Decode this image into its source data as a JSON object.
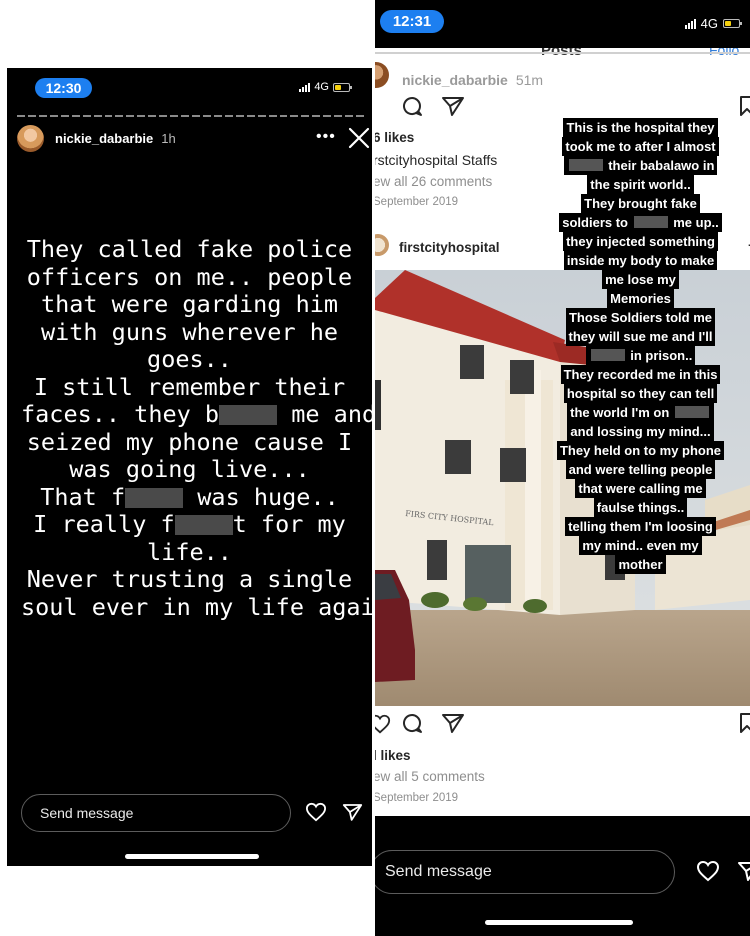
{
  "left_story": {
    "status_time": "12:30",
    "network": "4G",
    "username": "nickie_dabarbie",
    "posted_ago": "1h",
    "more_label": "•••",
    "text_lines": [
      {
        "parts": [
          "They called fake police"
        ]
      },
      {
        "parts": [
          "officers on me.. people"
        ]
      },
      {
        "parts": [
          "that were garding him"
        ]
      },
      {
        "parts": [
          "with guns wherever he"
        ]
      },
      {
        "parts": [
          "goes.."
        ]
      },
      {
        "parts": [
          "I still remember their"
        ]
      },
      {
        "parts": [
          "faces.. they b",
          "",
          " me and"
        ]
      },
      {
        "parts": [
          "seized my phone cause I"
        ]
      },
      {
        "parts": [
          "was going live..."
        ]
      },
      {
        "parts": [
          "That f",
          "",
          " was huge.."
        ]
      },
      {
        "parts": [
          "I really f",
          "",
          "t for my"
        ]
      },
      {
        "parts": [
          "life.."
        ]
      },
      {
        "parts": [
          "Never trusting a single"
        ]
      },
      {
        "parts": [
          "soul ever in my life again"
        ]
      }
    ],
    "message_placeholder": "Send message"
  },
  "right_story": {
    "status_time": "12:31",
    "network": "4G",
    "feed_header": {
      "title": "Posts",
      "follow": "Follo"
    },
    "post1": {
      "username": "nickie_dabarbie",
      "posted_ago": "51m",
      "likes": "6 likes",
      "caption": "rstcityhospital Staffs",
      "comments": "ew all 26 comments",
      "date": "September 2019"
    },
    "post2": {
      "account": "firstcityhospital",
      "sign_text": "FIRS  CITY HOSPITAL",
      "likes": "l likes",
      "comments": "ew all 5 comments",
      "date": "September 2019"
    },
    "overlay_lines": [
      {
        "parts": [
          "This is the hospital they"
        ]
      },
      {
        "parts": [
          "took me to after I almost"
        ]
      },
      {
        "parts": [
          "",
          " their babalawo in"
        ]
      },
      {
        "parts": [
          "the spirit world.."
        ]
      },
      {
        "parts": [
          "They brought fake"
        ]
      },
      {
        "parts": [
          "soldiers to ",
          "",
          " me up.."
        ]
      },
      {
        "parts": [
          "they injected something"
        ]
      },
      {
        "parts": [
          "inside my body to make"
        ]
      },
      {
        "parts": [
          "me lose my"
        ]
      },
      {
        "parts": [
          "Memories"
        ]
      },
      {
        "parts": [
          "Those Soldiers told me"
        ]
      },
      {
        "parts": [
          "they will sue me and I'll"
        ]
      },
      {
        "parts": [
          "",
          " in prison.."
        ]
      },
      {
        "parts": [
          "They recorded me in this"
        ]
      },
      {
        "parts": [
          "hospital so they can tell"
        ]
      },
      {
        "parts": [
          "the world I'm on ",
          ""
        ]
      },
      {
        "parts": [
          "and lossing my mind..."
        ]
      },
      {
        "parts": [
          "They held on to my phone"
        ]
      },
      {
        "parts": [
          "and were telling people"
        ]
      },
      {
        "parts": [
          "that were calling me"
        ]
      },
      {
        "parts": [
          "faulse things.."
        ]
      },
      {
        "parts": [
          "telling them I'm loosing"
        ]
      },
      {
        "parts": [
          "my mind.. even my"
        ]
      },
      {
        "parts": [
          "mother"
        ]
      }
    ],
    "message_placeholder": "Send message"
  },
  "colors": {
    "time_pill": "#1d7ff0",
    "story_bg": "#000000",
    "battery": "#f5d10f",
    "building_wall": "#f3ede0",
    "roof": "#b0312a"
  },
  "icons": [
    "close-icon",
    "more-icon",
    "heart-icon",
    "send-icon",
    "comment-icon",
    "bookmark-icon",
    "signal-icon",
    "battery-icon"
  ]
}
